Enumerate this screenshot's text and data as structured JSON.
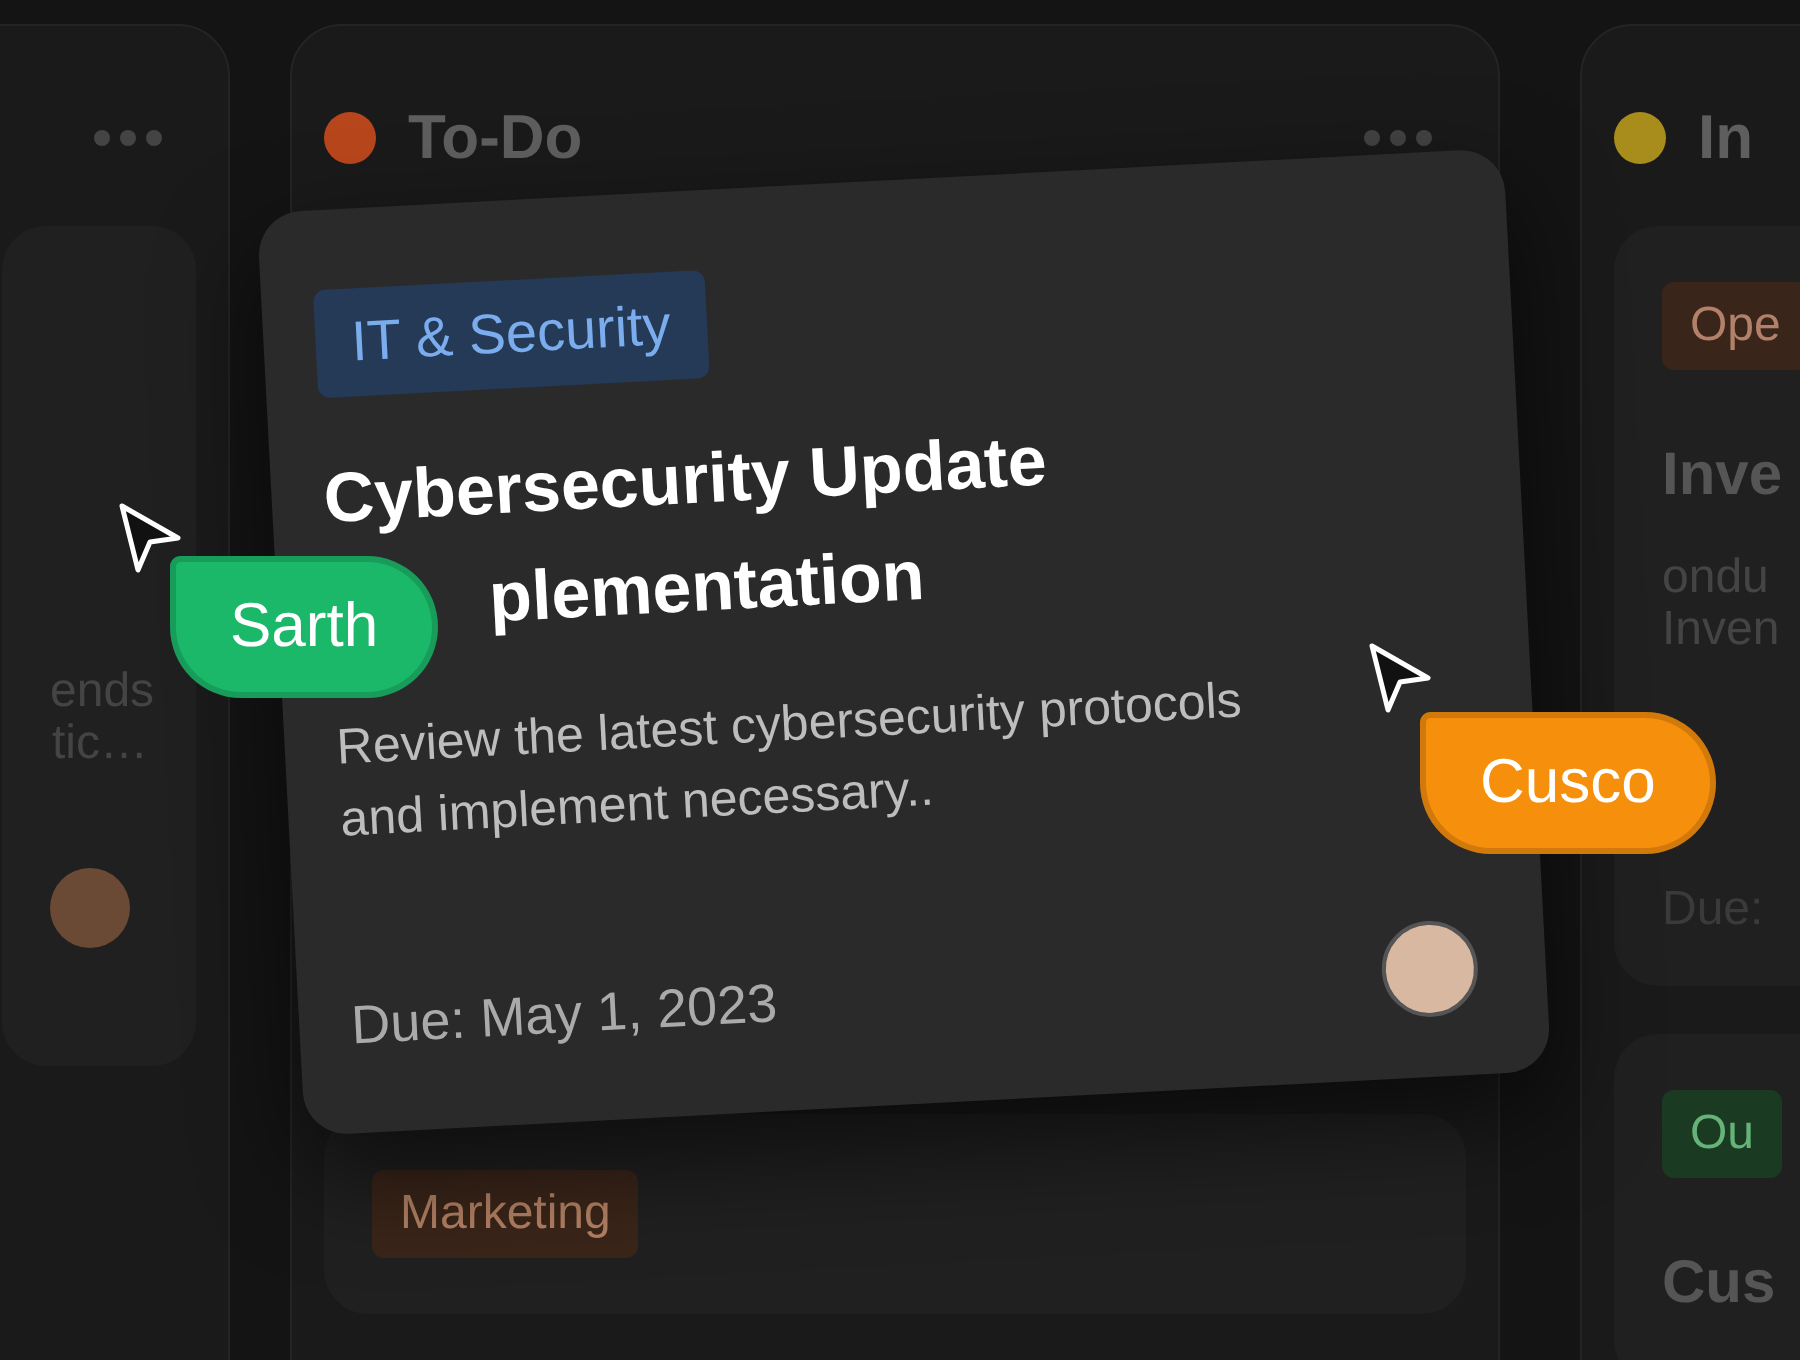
{
  "columns": [
    {
      "menu": true,
      "cards": [
        {
          "description_lines": [
            "ends",
            "tic…"
          ],
          "avatar": true
        }
      ]
    },
    {
      "title": "To-Do",
      "color": "#b8461c",
      "menu": true,
      "cards": [
        {
          "tag": {
            "label": "Marketing",
            "color": "#3a2519"
          }
        }
      ]
    },
    {
      "title": "In",
      "color": "#a88d1c",
      "cards": [
        {
          "tag": {
            "label": "Ope",
            "color": "#3a251b"
          },
          "title": "Inve",
          "description_lines": [
            "ondu",
            "Inven"
          ],
          "due": "Due:"
        },
        {
          "tag": {
            "label": "Ou",
            "color": "#1a3a22"
          },
          "title": "Cus"
        }
      ]
    }
  ],
  "drag_card": {
    "tag": {
      "label": "IT & Security",
      "color": "#243a56"
    },
    "title_lines": [
      "Cybersecurity Update",
      "plementation"
    ],
    "description": "Review the latest cybersecurity protocols and implement necessary..",
    "due": "Due: May 1, 2023",
    "avatar": true
  },
  "cursors": [
    {
      "name": "Sarth",
      "color": "#1cb86a"
    },
    {
      "name": "Cusco",
      "color": "#f68f0c"
    }
  ]
}
